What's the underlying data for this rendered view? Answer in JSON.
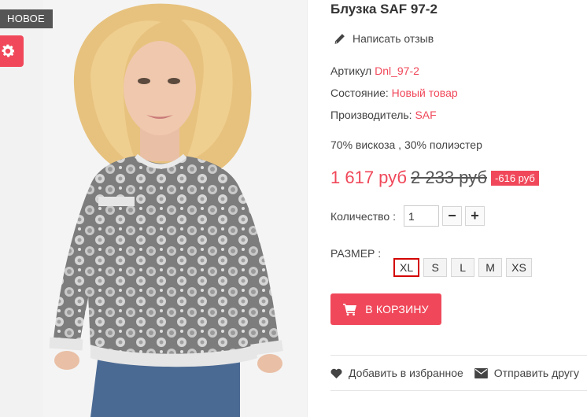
{
  "badge": {
    "new_label": "НОВОЕ"
  },
  "product": {
    "title": "Блузка SAF 97-2",
    "review_link": "Написать отзыв",
    "sku_label": "Артикул",
    "sku_value": "Dnl_97-2",
    "condition_label": "Состояние:",
    "condition_value": "Новый товар",
    "manufacturer_label": "Производитель:",
    "manufacturer_value": "SAF",
    "composition": "70% вискоза , 30% полиэстер"
  },
  "price": {
    "current": "1 617 руб",
    "old": "2 233 руб",
    "discount": "-616 руб"
  },
  "quantity": {
    "label": "Количество :",
    "value": "1",
    "minus": "−",
    "plus": "+"
  },
  "size": {
    "label": "РАЗМЕР :",
    "options": [
      "XL",
      "S",
      "L",
      "M",
      "XS"
    ],
    "selected": "XL"
  },
  "cart_button": "В КОРЗИНУ",
  "actions": {
    "wishlist": "Добавить в избранное",
    "send_friend": "Отправить другу"
  },
  "icons": {
    "settings": "gear-icon",
    "review": "pencil-icon",
    "cart": "cart-icon",
    "wishlist": "heart-icon",
    "send": "envelope-icon"
  },
  "colors": {
    "accent": "#f0485a",
    "badge_bg": "#555555",
    "selected_size_border": "#d40000"
  }
}
